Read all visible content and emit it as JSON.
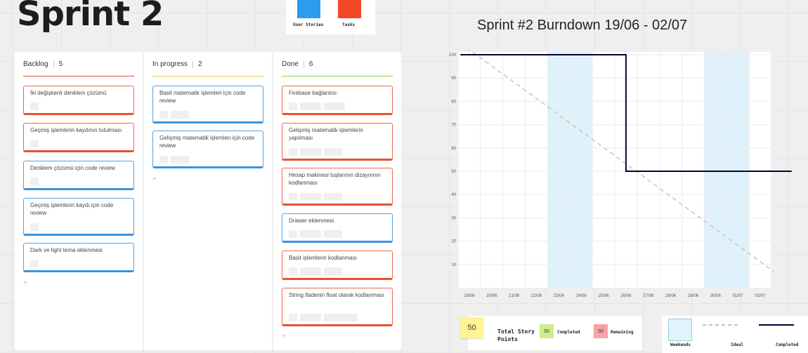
{
  "board_title": "Sprint 2",
  "legend": {
    "user_stories": "User Stories",
    "tasks": "Tasks"
  },
  "columns": [
    {
      "name": "Backlog",
      "count": "5",
      "cards": [
        {
          "text": "İki değişkenli denklem çözümü",
          "color": "red"
        },
        {
          "text": "Geçmiş işlemlerin kaydının tutulması",
          "color": "red"
        },
        {
          "text": "Denklem çözümü için code review",
          "color": "blue"
        },
        {
          "text": "Geçmiş işlemlerin kaydı için code review",
          "color": "blue"
        },
        {
          "text": "Dark ve light tema eklenmesi",
          "color": "blue"
        }
      ]
    },
    {
      "name": "In progress",
      "count": "2",
      "cards": [
        {
          "text": "Basit matematik işlemleri için code review",
          "color": "blue"
        },
        {
          "text": "Gelişmiş matematik işlemleri için code review",
          "color": "blue"
        }
      ]
    },
    {
      "name": "Done",
      "count": "6",
      "cards": [
        {
          "text": "Firebase bağlantısı",
          "color": "red"
        },
        {
          "text": "Gelişmiş matematik işlemlerin yapılması",
          "color": "red"
        },
        {
          "text": "Hesap makinesi tuşlarının dizaynının kodlanması",
          "color": "red"
        },
        {
          "text": "Drawer eklenmesi",
          "color": "blue"
        },
        {
          "text": "Basit işlemlerin kodlanması",
          "color": "red"
        },
        {
          "text": "String ifadenin float olarak kodlanması",
          "color": "red"
        }
      ]
    }
  ],
  "colors": {
    "red": "#e5532f",
    "blue": "#2d9bf0",
    "backlog_line": "#e5532f",
    "inprogress_line": "#f2c94c",
    "done_line": "#8fd14f",
    "weekend": "#dff2fb",
    "completed": "#050038",
    "ideal": "#c3c3c3"
  },
  "chart_data": {
    "type": "line",
    "title": "Sprint #2 Burndown 19/06 - 02/07",
    "categories": [
      "19/06",
      "20/06",
      "21/06",
      "22/06",
      "23/06",
      "24/06",
      "25/06",
      "26/06",
      "27/06",
      "28/06",
      "29/06",
      "30/06",
      "01/07",
      "02/07"
    ],
    "ylim": [
      0,
      100
    ],
    "yticks": [
      10,
      20,
      30,
      40,
      50,
      60,
      70,
      80,
      90,
      100
    ],
    "weekends": [
      [
        "23/06",
        "24/06"
      ],
      [
        "30/06",
        "01/07"
      ]
    ],
    "series": [
      {
        "name": "Ideal",
        "style": "dashed",
        "points": [
          [
            -0.4,
            105
          ],
          [
            13.6,
            7
          ]
        ]
      },
      {
        "name": "Completed",
        "style": "step",
        "points": [
          [
            -0.4,
            100
          ],
          [
            7,
            100
          ],
          [
            7,
            50
          ],
          [
            14.4,
            50
          ]
        ]
      }
    ]
  },
  "story_points": {
    "total": "50",
    "total_label": "Total Story Points",
    "completed_value": "50",
    "completed_label": "Completed",
    "remaining_value": "50",
    "remaining_label": "Remaining"
  },
  "chart_key": {
    "weekends": "Weekends",
    "ideal": "Ideal",
    "completed": "Completed"
  }
}
